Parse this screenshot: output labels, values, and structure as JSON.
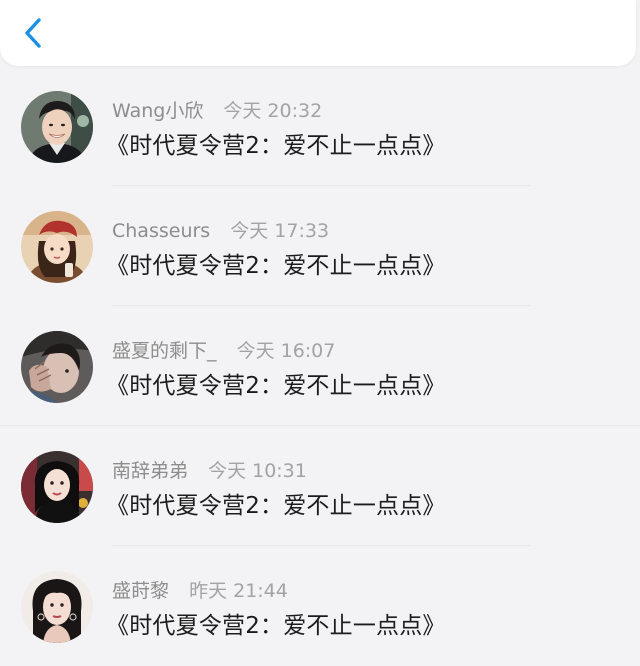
{
  "header": {
    "back_icon": "chevron-left-icon",
    "accent_color": "#1a90e6"
  },
  "comments": [
    {
      "username": "Wang小欣",
      "time": "今天 20:32",
      "message": "《时代夏令营2：爱不止一点点》",
      "avatar_icon": "avatar-young-man-smiling"
    },
    {
      "username": "Chasseurs",
      "time": "今天 17:33",
      "message": "《时代夏令营2：爱不止一点点》",
      "avatar_icon": "avatar-illustrated-girl-red-beret"
    },
    {
      "username": "盛夏的剩下_",
      "time": "今天 16:07",
      "message": "《时代夏令营2：爱不止一点点》",
      "avatar_icon": "avatar-person-covering-face"
    },
    {
      "username": "南辞弟弟",
      "time": "今天 10:31",
      "message": "《时代夏令营2：爱不止一点点》",
      "avatar_icon": "avatar-woman-dark-hair"
    },
    {
      "username": "盛莳黎",
      "time": "昨天 21:44",
      "message": "《时代夏令营2：爱不止一点点》",
      "avatar_icon": "avatar-woman-earrings"
    }
  ]
}
